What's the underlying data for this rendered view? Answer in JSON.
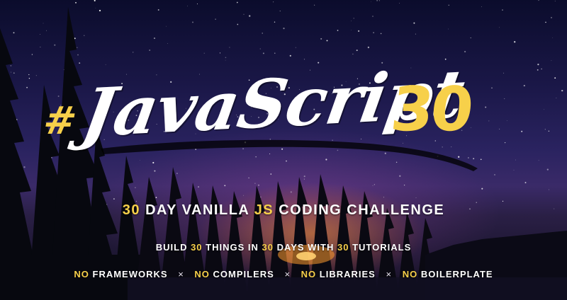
{
  "logo": {
    "hash": "#",
    "word": "JavaScript",
    "number": "30"
  },
  "tagline": {
    "num": "30",
    "part1": "DAY VANILLA",
    "js": "JS",
    "part2": "CODING CHALLENGE"
  },
  "build_line": {
    "w1": "BUILD",
    "n1": "30",
    "w2": "THINGS IN",
    "n2": "30",
    "w3": "DAYS WITH",
    "n3": "30",
    "w4": "TUTORIALS"
  },
  "no_list": {
    "no_word": "NO",
    "separator": "×",
    "items": [
      "FRAMEWORKS",
      "COMPILERS",
      "LIBRARIES",
      "BOILERPLATE"
    ]
  },
  "colors": {
    "accent": "#f7d04a",
    "text": "#ffffff",
    "sky_top": "#0b0c2c",
    "campfire": "#ff9628"
  }
}
